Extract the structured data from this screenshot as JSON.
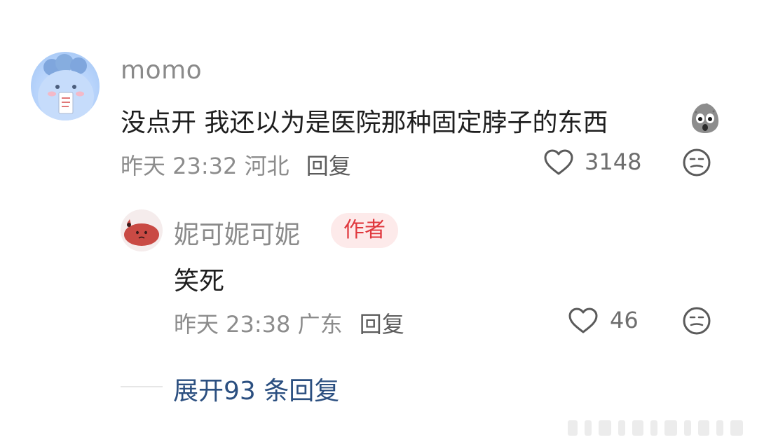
{
  "main_comment": {
    "username": "momo",
    "text": "没点开 我还以为是医院那种固定脖子的东西",
    "emoji_icon": "shocked-grey-blob-emoji",
    "date": "昨天 23:32",
    "location": "河北",
    "reply_label": "回复",
    "like_count": "3148"
  },
  "reply_comment": {
    "username": "妮可妮可妮",
    "badge": "作者",
    "text": "笑死",
    "date": "昨天 23:38",
    "location": "广东",
    "reply_label": "回复",
    "like_count": "46"
  },
  "expand": {
    "label": "展开93 条回复"
  },
  "colors": {
    "accent_link": "#2b4f80",
    "badge_text": "#e0383e",
    "badge_bg": "#fdeaea",
    "muted_text": "#8c8c8c"
  }
}
